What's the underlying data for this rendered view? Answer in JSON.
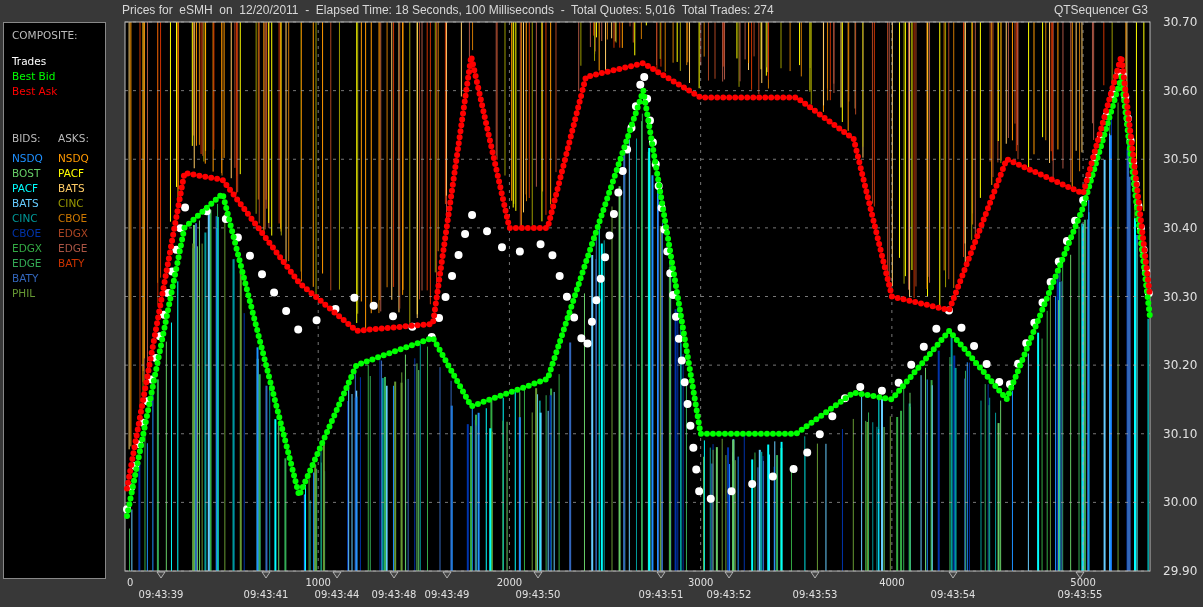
{
  "header": {
    "title": "Prices for  eSMH  on  12/20/2011  -  Elapsed Time: 18 Seconds, 100 Milliseconds  -  Total Quotes: 5,016  Total Trades: 274",
    "app_name": "QTSequencer G3"
  },
  "legend": {
    "composite_heading": "COMPOSITE:",
    "bids_heading": "BIDS:",
    "asks_heading": "ASKS:",
    "bids": [
      {
        "label": "NSDQ",
        "color": "#1e90ff"
      },
      {
        "label": "BOST",
        "color": "#66cc66"
      },
      {
        "label": "PACF",
        "color": "#00ffff"
      },
      {
        "label": "BATS",
        "color": "#66ccff"
      },
      {
        "label": "CINC",
        "color": "#009999"
      },
      {
        "label": "CBOE",
        "color": "#0033aa"
      },
      {
        "label": "EDGX",
        "color": "#33aa44"
      },
      {
        "label": "EDGE",
        "color": "#33aa55"
      },
      {
        "label": "BATY",
        "color": "#3366bb"
      },
      {
        "label": "PHIL",
        "color": "#669933"
      }
    ],
    "asks": [
      {
        "label": "NSDQ",
        "color": "#ff9900"
      },
      {
        "label": "PACF",
        "color": "#ffff00"
      },
      {
        "label": "BATS",
        "color": "#ffcc66"
      },
      {
        "label": "CINC",
        "color": "#999900"
      },
      {
        "label": "CBOE",
        "color": "#cc7700"
      },
      {
        "label": "EDGX",
        "color": "#aa4422"
      },
      {
        "label": "EDGE",
        "color": "#aa5544"
      },
      {
        "label": "BATY",
        "color": "#cc3300"
      }
    ]
  },
  "chart": {
    "chart_data": {
      "type": "line",
      "x": [
        0,
        300,
        500,
        900,
        1200,
        1600,
        1800,
        2000,
        2200,
        2400,
        2700,
        3000,
        3500,
        3800,
        4000,
        4300,
        4600,
        5000,
        5200,
        5350
      ],
      "series": [
        {
          "name": "Trades",
          "color": "#ffffff",
          "line_style": "dotted",
          "values": [
            29.99,
            30.43,
            30.42,
            30.25,
            30.3,
            30.24,
            30.42,
            30.36,
            30.38,
            30.22,
            30.63,
            30,
            30.05,
            30.17,
            30.16,
            30.28,
            30.16,
            30.44,
            30.64,
            30.29
          ]
        },
        {
          "name": "Best Bid",
          "color": "#00ff00",
          "line_style": "dotted",
          "values": [
            29.98,
            30.4,
            30.45,
            30.01,
            30.2,
            30.24,
            30.14,
            30.16,
            30.18,
            30.35,
            30.6,
            30.1,
            30.1,
            30.16,
            30.15,
            30.25,
            30.15,
            30.43,
            30.62,
            30.27
          ]
        },
        {
          "name": "Best Ask",
          "color": "#ff0000",
          "line_style": "dotted",
          "values": [
            30.02,
            30.48,
            30.47,
            30.32,
            30.25,
            30.26,
            30.65,
            30.4,
            30.4,
            30.62,
            30.64,
            30.59,
            30.59,
            30.53,
            30.3,
            30.28,
            30.5,
            30.45,
            30.65,
            30.3
          ]
        }
      ],
      "xlim": [
        0,
        5350
      ],
      "ylim": [
        29.9,
        30.7
      ],
      "grid": true,
      "xticks": [
        0,
        1000,
        2000,
        3000,
        4000,
        5000
      ],
      "yticks": [
        {
          "value": 29.9,
          "label": "29.90"
        },
        {
          "value": 30,
          "label": "30.00"
        },
        {
          "value": 30.1,
          "label": "30.10"
        },
        {
          "value": 30.2,
          "label": "30.20"
        },
        {
          "value": 30.3,
          "label": "30.30"
        },
        {
          "value": 30.4,
          "label": "30.40"
        },
        {
          "value": 30.5,
          "label": "30.50"
        },
        {
          "value": 30.6,
          "label": "30.60"
        },
        {
          "value": 30.7,
          "label": "30.70"
        }
      ]
    },
    "time_labels": [
      "09:43:39",
      "09:43:41",
      "09:43:44",
      "09:43:48",
      "09:43:49",
      "09:43:50",
      "09:43:51",
      "09:43:52",
      "09:43:53",
      "09:43:54",
      "09:43:55"
    ]
  }
}
